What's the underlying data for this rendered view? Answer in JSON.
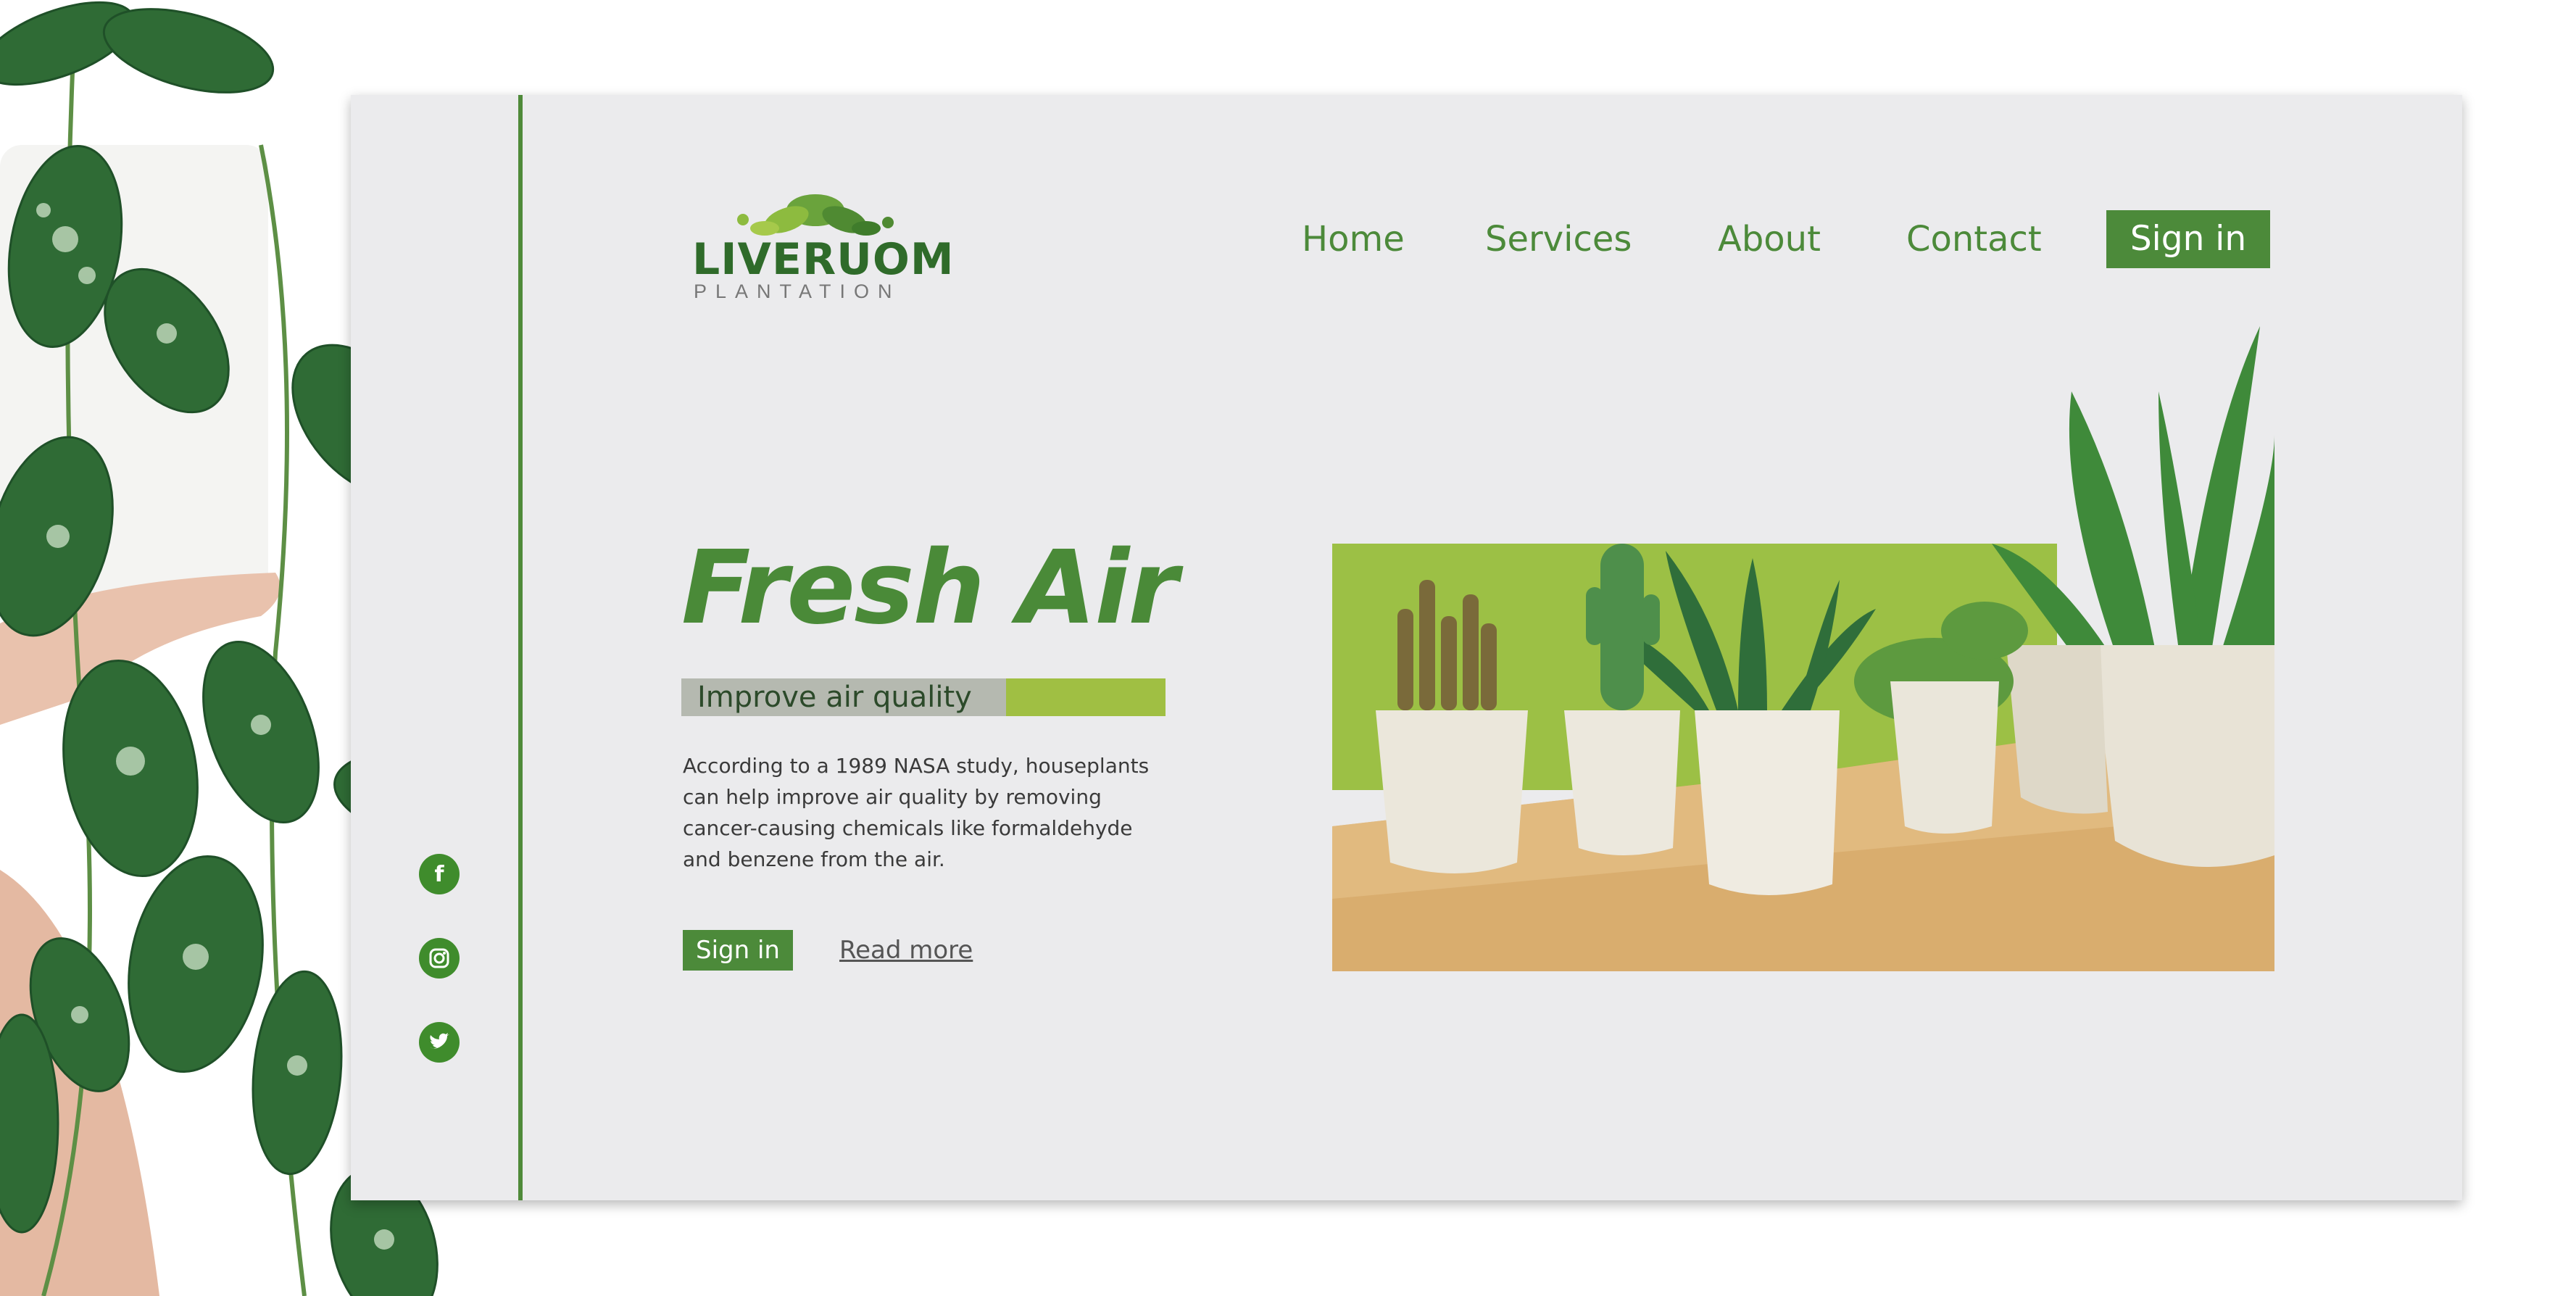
{
  "brand": {
    "name": "LIVERUOM",
    "tagline": "PLANTATION"
  },
  "nav": {
    "items": [
      {
        "label": "Home"
      },
      {
        "label": "Services"
      },
      {
        "label": "About"
      },
      {
        "label": "Contact"
      }
    ],
    "signin_label": "Sign in"
  },
  "hero": {
    "title": "Fresh Air",
    "subtitle": "Improve air quality",
    "body": "According to a 1989 NASA study, houseplants can help improve air quality by removing cancer-causing chemicals like formaldehyde and benzene from the air.",
    "signin_label": "Sign in",
    "read_more_label": "Read more"
  },
  "social": [
    {
      "icon": "facebook-icon"
    },
    {
      "icon": "instagram-icon"
    },
    {
      "icon": "twitter-icon"
    }
  ],
  "colors": {
    "brand_green": "#4c8a3a",
    "accent_lime": "#a0bf43",
    "card_bg": "#ebebed"
  }
}
